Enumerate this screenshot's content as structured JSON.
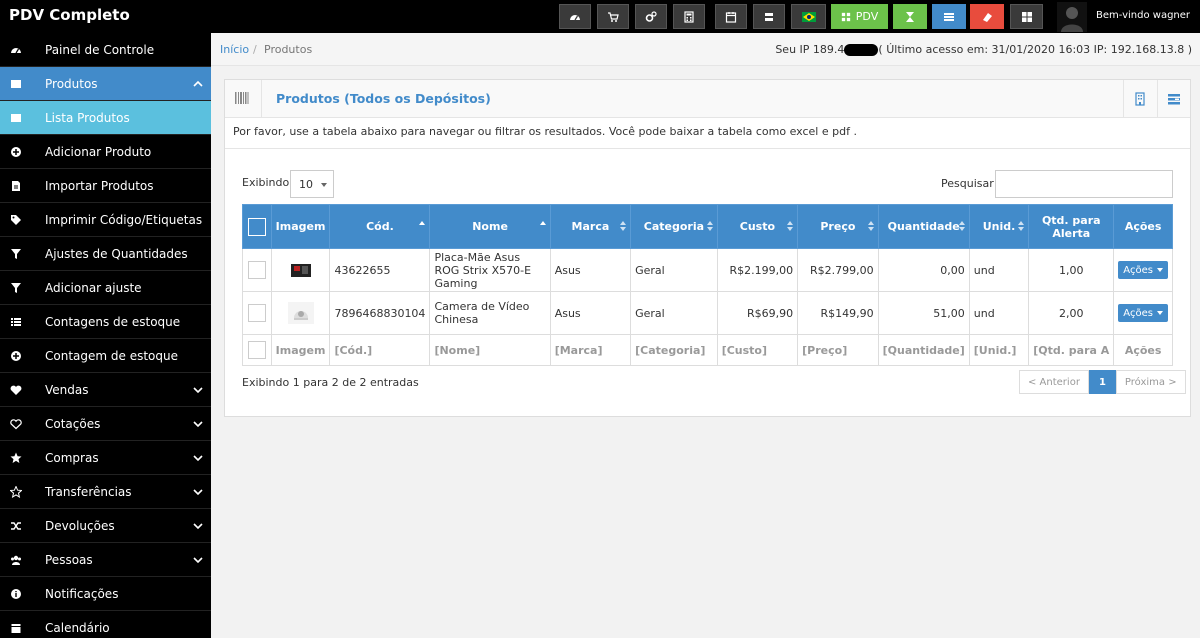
{
  "app": {
    "brand": "PDV Completo",
    "welcome": "Bem-vindo wagner",
    "pdv_label": "PDV"
  },
  "sidebar": {
    "items": [
      {
        "label": "Painel de Controle",
        "icon": "dashboard-icon"
      },
      {
        "label": "Produtos",
        "icon": "barcode-icon",
        "expanded": true
      },
      {
        "label": "Lista Produtos",
        "icon": "barcode-icon",
        "selected": true
      },
      {
        "label": "Adicionar Produto",
        "icon": "plus-circle-icon"
      },
      {
        "label": "Importar Produtos",
        "icon": "file-icon"
      },
      {
        "label": "Imprimir Código/Etiquetas",
        "icon": "tags-icon"
      },
      {
        "label": "Ajustes de Quantidades",
        "icon": "filter-icon"
      },
      {
        "label": "Adicionar ajuste",
        "icon": "filter-icon"
      },
      {
        "label": "Contagens de estoque",
        "icon": "list-icon"
      },
      {
        "label": "Contagem de estoque",
        "icon": "plus-circle-icon"
      },
      {
        "label": "Vendas",
        "icon": "heart-icon"
      },
      {
        "label": "Cotações",
        "icon": "heart-outline-icon"
      },
      {
        "label": "Compras",
        "icon": "star-icon"
      },
      {
        "label": "Transferências",
        "icon": "star-outline-icon"
      },
      {
        "label": "Devoluções",
        "icon": "random-icon"
      },
      {
        "label": "Pessoas",
        "icon": "users-icon"
      },
      {
        "label": "Notificações",
        "icon": "info-icon"
      },
      {
        "label": "Calendário",
        "icon": "calendar-icon"
      }
    ]
  },
  "breadcrumb": {
    "home": "Início",
    "sep": "/",
    "current": "Produtos"
  },
  "ip": {
    "prefix": "Seu IP 189.4",
    "suffix": "( Último acesso em: 31/01/2020 16:03 IP: 192.168.13.8 )"
  },
  "box": {
    "title": "Produtos (Todos os Depósitos)",
    "intro": "Por favor, use a tabela abaixo para navegar ou filtrar os resultados. Você pode baixar a tabela como excel e pdf ."
  },
  "table_controls": {
    "length_label": "Exibindo",
    "length_value": "10",
    "search_label": "Pesquisar",
    "search_value": ""
  },
  "table": {
    "headers": [
      "Imagem",
      "Cód.",
      "Nome",
      "Marca",
      "Categoria",
      "Custo",
      "Preço",
      "Quantidade",
      "Unid.",
      "Qtd. para Alerta",
      "Ações"
    ],
    "rows": [
      {
        "code": "43622655",
        "name": "Placa-Mãe Asus ROG Strix X570-E Gaming",
        "brand": "Asus",
        "category": "Geral",
        "cost": "R$2.199,00",
        "price": "R$2.799,00",
        "qty": "0,00",
        "unit": "und",
        "alert": "1,00",
        "action": "Ações"
      },
      {
        "code": "7896468830104",
        "name": "Camera de Vídeo Chinesa",
        "brand": "Asus",
        "category": "Geral",
        "cost": "R$69,90",
        "price": "R$149,90",
        "qty": "51,00",
        "unit": "und",
        "alert": "2,00",
        "action": "Ações"
      }
    ],
    "footer": [
      "Imagem",
      "[Cód.]",
      "[Nome]",
      "[Marca]",
      "[Categoria]",
      "[Custo]",
      "[Preço]",
      "[Quantidade]",
      "[Unid.]",
      "[Qtd. para A",
      "Ações"
    ]
  },
  "pagination": {
    "info": "Exibindo 1 para 2 de 2 entradas",
    "prev": "< Anterior",
    "page": "1",
    "next": "Próxima >"
  },
  "colors": {
    "primary": "#428bca",
    "sidebar_bg": "#000000",
    "sub_active": "#5bc0de",
    "pdv_green": "#6cc24a",
    "red": "#e84c3d"
  }
}
